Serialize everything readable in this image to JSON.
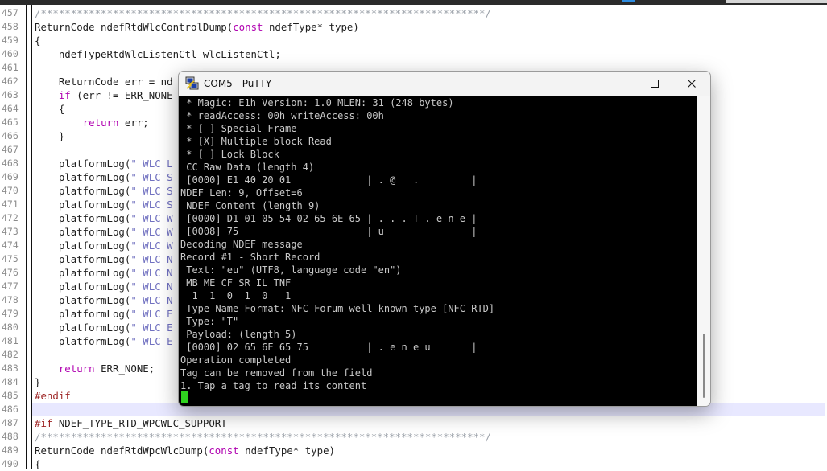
{
  "editor": {
    "gutter": [
      "457",
      "458",
      "459",
      "460",
      "461",
      "462",
      "463",
      "464",
      "465",
      "466",
      "467",
      "468",
      "469",
      "470",
      "471",
      "472",
      "473",
      "474",
      "475",
      "476",
      "477",
      "478",
      "479",
      "480",
      "481",
      "482",
      "483",
      "484",
      "485",
      "486",
      "487",
      "488",
      "489",
      "490"
    ],
    "lines": [
      [
        {
          "t": "/**************************************************************************/",
          "c": "cm"
        }
      ],
      [
        {
          "t": "ReturnCode ndefRtdWlcControlDump("
        },
        {
          "t": "const",
          "c": "kw"
        },
        {
          "t": " ndefType* type)"
        }
      ],
      [
        {
          "t": "{"
        }
      ],
      [
        {
          "t": "    ndefTypeRtdWlcListenCtl wlcListenCtl;"
        }
      ],
      [
        {
          "t": ""
        }
      ],
      [
        {
          "t": "    ReturnCode err = nd"
        }
      ],
      [
        {
          "t": "    "
        },
        {
          "t": "if",
          "c": "kw"
        },
        {
          "t": " (err != ERR_NONE"
        }
      ],
      [
        {
          "t": "    {"
        }
      ],
      [
        {
          "t": "        "
        },
        {
          "t": "return",
          "c": "kw"
        },
        {
          "t": " err;"
        }
      ],
      [
        {
          "t": "    }"
        }
      ],
      [
        {
          "t": ""
        }
      ],
      [
        {
          "t": "    platformLog("
        },
        {
          "t": "\" WLC L",
          "c": "st"
        }
      ],
      [
        {
          "t": "    platformLog("
        },
        {
          "t": "\" WLC S",
          "c": "st"
        }
      ],
      [
        {
          "t": "    platformLog("
        },
        {
          "t": "\" WLC S",
          "c": "st"
        }
      ],
      [
        {
          "t": "    platformLog("
        },
        {
          "t": "\" WLC S",
          "c": "st"
        }
      ],
      [
        {
          "t": "    platformLog("
        },
        {
          "t": "\" WLC W",
          "c": "st"
        }
      ],
      [
        {
          "t": "    platformLog("
        },
        {
          "t": "\" WLC W",
          "c": "st"
        }
      ],
      [
        {
          "t": "    platformLog("
        },
        {
          "t": "\" WLC W",
          "c": "st"
        }
      ],
      [
        {
          "t": "    platformLog("
        },
        {
          "t": "\" WLC N",
          "c": "st"
        }
      ],
      [
        {
          "t": "    platformLog("
        },
        {
          "t": "\" WLC N",
          "c": "st"
        }
      ],
      [
        {
          "t": "    platformLog("
        },
        {
          "t": "\" WLC N",
          "c": "st"
        }
      ],
      [
        {
          "t": "    platformLog("
        },
        {
          "t": "\" WLC N",
          "c": "st"
        }
      ],
      [
        {
          "t": "    platformLog("
        },
        {
          "t": "\" WLC E",
          "c": "st"
        }
      ],
      [
        {
          "t": "    platformLog("
        },
        {
          "t": "\" WLC E",
          "c": "st"
        }
      ],
      [
        {
          "t": "    platformLog("
        },
        {
          "t": "\" WLC E",
          "c": "st"
        }
      ],
      [
        {
          "t": ""
        }
      ],
      [
        {
          "t": "    "
        },
        {
          "t": "return",
          "c": "kw"
        },
        {
          "t": " ERR_NONE;"
        }
      ],
      [
        {
          "t": "}"
        }
      ],
      [
        {
          "t": "#endif",
          "c": "pp"
        }
      ],
      [
        {
          "t": ""
        }
      ],
      [
        {
          "t": "#if",
          "c": "pp"
        },
        {
          "t": " NDEF_TYPE_RTD_WPCWLC_SUPPORT"
        }
      ],
      [
        {
          "t": "/**************************************************************************/",
          "c": "cm"
        }
      ],
      [
        {
          "t": "ReturnCode ndefRtdWpcWlcDump("
        },
        {
          "t": "const",
          "c": "kw"
        },
        {
          "t": " ndefType* type)"
        }
      ],
      [
        {
          "t": "{"
        }
      ]
    ],
    "current_line_index": 29
  },
  "putty": {
    "title": "COM5 - PuTTY",
    "lines": [
      " * Magic: E1h Version: 1.0 MLEN: 31 (248 bytes)",
      " * readAccess: 00h writeAccess: 00h",
      " * [ ] Special Frame",
      " * [X] Multiple block Read",
      " * [ ] Lock Block",
      " CC Raw Data (length 4)",
      " [0000] E1 40 20 01             | . @   .         |",
      "NDEF Len: 9, Offset=6",
      " NDEF Content (length 9)",
      " [0000] D1 01 05 54 02 65 6E 65 | . . . T . e n e |",
      " [0008] 75                      | u               |",
      "Decoding NDEF message",
      "Record #1 - Short Record",
      " Text: \"eu\" (UTF8, language code \"en\")",
      " MB ME CF SR IL TNF",
      "  1  1  0  1  0   1",
      " Type Name Format: NFC Forum well-known type [NFC RTD]",
      " Type: \"T\"",
      " Payload: (length 5)",
      " [0000] 02 65 6E 65 75          | . e n e u       |",
      "Operation completed",
      "Tag can be removed from the field",
      "1. Tap a tag to read its content"
    ]
  },
  "colors": {
    "terminal_bg": "#000000",
    "terminal_fg": "#c8c8c8",
    "cursor": "#2fd41f",
    "keyword": "#b000b0",
    "preprocessor": "#9b1f1f",
    "comment": "#9aa0a8",
    "string": "#7070c0",
    "current_line": "#e8e8ff"
  },
  "icons": {
    "app": "putty-icon",
    "minimize": "minimize-icon",
    "maximize": "maximize-icon",
    "close": "close-icon"
  }
}
